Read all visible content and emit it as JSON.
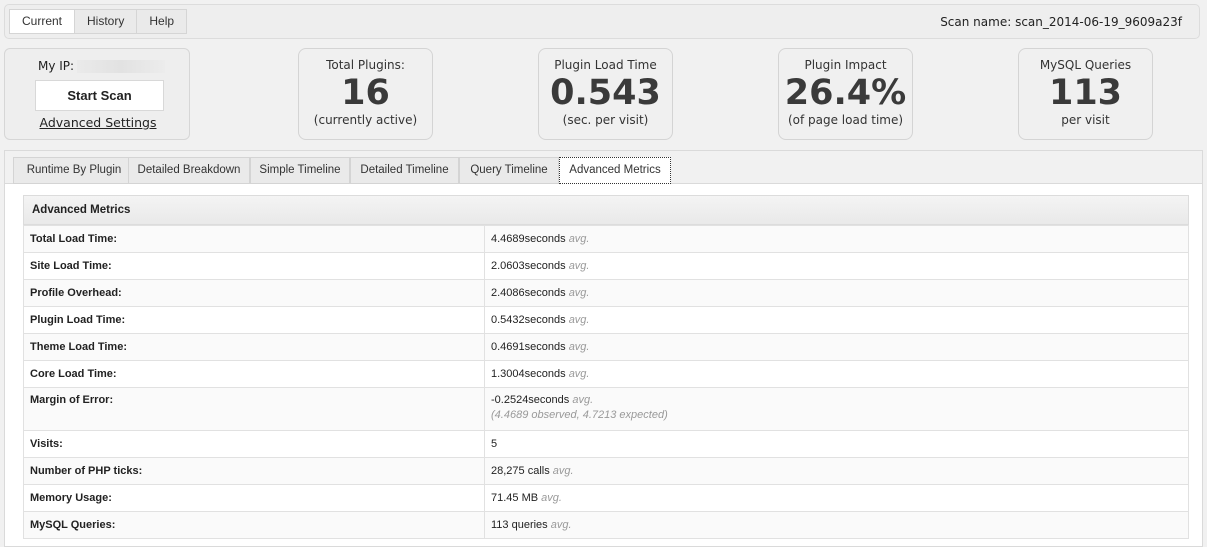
{
  "top_tabs": [
    {
      "label": "Current",
      "active": true
    },
    {
      "label": "History",
      "active": false
    },
    {
      "label": "Help",
      "active": false
    }
  ],
  "scan_name": "Scan name: scan_2014-06-19_9609a23f",
  "ip_box": {
    "label": "My IP:",
    "start_scan": "Start Scan",
    "advanced_settings": "Advanced Settings"
  },
  "stats": [
    {
      "title": "Total Plugins:",
      "value": "16",
      "sub": "(currently active)"
    },
    {
      "title": "Plugin Load Time",
      "value": "0.543",
      "sub": "(sec. per visit)"
    },
    {
      "title": "Plugin Impact",
      "value": "26.4%",
      "sub": "(of page load time)"
    },
    {
      "title": "MySQL Queries",
      "value": "113",
      "sub": "per visit"
    }
  ],
  "sub_tabs": [
    {
      "label": "Runtime By Plugin",
      "active": false
    },
    {
      "label": "Detailed Breakdown",
      "active": false
    },
    {
      "label": "Simple Timeline",
      "active": false
    },
    {
      "label": "Detailed Timeline",
      "active": false
    },
    {
      "label": "Query Timeline",
      "active": false
    },
    {
      "label": "Advanced Metrics",
      "active": true
    }
  ],
  "metrics": {
    "header": "Advanced Metrics",
    "rows": [
      {
        "label": "Total Load Time:",
        "value": "4.4689seconds",
        "suffix": "avg."
      },
      {
        "label": "Site Load Time:",
        "value": "2.0603seconds",
        "suffix": "avg."
      },
      {
        "label": "Profile Overhead:",
        "value": "2.4086seconds",
        "suffix": "avg."
      },
      {
        "label": "Plugin Load Time:",
        "value": "0.5432seconds",
        "suffix": "avg."
      },
      {
        "label": "Theme Load Time:",
        "value": "0.4691seconds",
        "suffix": "avg."
      },
      {
        "label": "Core Load Time:",
        "value": "1.3004seconds",
        "suffix": "avg."
      },
      {
        "label": "Margin of Error:",
        "value": "-0.2524seconds",
        "suffix": "avg.",
        "note": "(4.4689 observed, 4.7213 expected)"
      },
      {
        "label": "Visits:",
        "value": "5",
        "suffix": ""
      },
      {
        "label": "Number of PHP ticks:",
        "value": "28,275 calls",
        "suffix": "avg."
      },
      {
        "label": "Memory Usage:",
        "value": "71.45 MB",
        "suffix": "avg."
      },
      {
        "label": "MySQL Queries:",
        "value": "113 queries",
        "suffix": "avg."
      }
    ]
  }
}
